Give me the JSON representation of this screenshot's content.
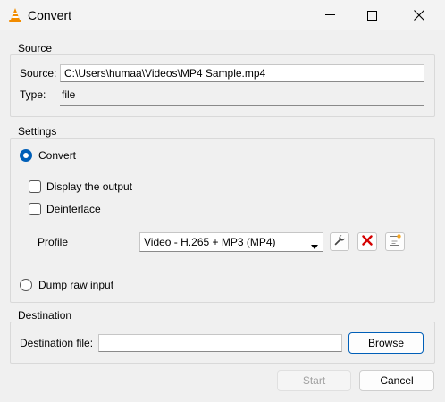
{
  "window": {
    "title": "Convert"
  },
  "icons": {
    "app": "vlc-cone-icon",
    "minimize": "minimize-icon",
    "maximize": "maximize-icon",
    "close": "close-icon",
    "edit_profile": "wrench-icon",
    "delete_profile": "red-x-icon",
    "new_profile": "new-profile-icon",
    "dropdown": "chevron-down-icon"
  },
  "source": {
    "group_title": "Source",
    "source_label": "Source:",
    "source_value": "C:\\Users\\humaa\\Videos\\MP4 Sample.mp4",
    "type_label": "Type:",
    "type_value": "file"
  },
  "settings": {
    "group_title": "Settings",
    "convert_label": "Convert",
    "convert_selected": true,
    "display_output_label": "Display the output",
    "display_output_checked": false,
    "deinterlace_label": "Deinterlace",
    "deinterlace_checked": false,
    "profile_label": "Profile",
    "profile_value": "Video - H.265 + MP3 (MP4)",
    "dump_raw_label": "Dump raw input",
    "dump_raw_selected": false
  },
  "destination": {
    "group_title": "Destination",
    "file_label": "Destination file:",
    "file_value": "",
    "browse_label": "Browse"
  },
  "footer": {
    "start_label": "Start",
    "start_enabled": false,
    "cancel_label": "Cancel"
  },
  "colors": {
    "accent": "#005fb8",
    "cone_orange": "#f28c00",
    "delete_red": "#d40000"
  }
}
